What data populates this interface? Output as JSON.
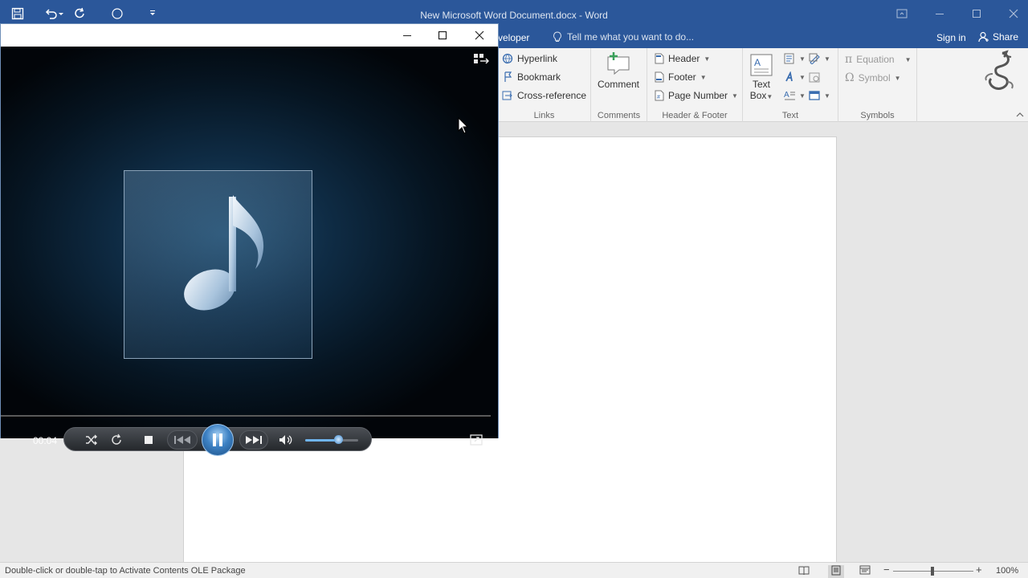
{
  "word": {
    "title": "New Microsoft Word Document.docx - Word",
    "tab_partial": "veloper",
    "tell_me": "Tell me what you want to do...",
    "sign_in": "Sign in",
    "share": "Share"
  },
  "ribbon": {
    "links": {
      "label": "Links",
      "items": [
        "Hyperlink",
        "Bookmark",
        "Cross-reference"
      ]
    },
    "comments": {
      "label": "Comments",
      "comment": "Comment"
    },
    "header_footer": {
      "label": "Header & Footer",
      "header": "Header",
      "footer": "Footer",
      "page_number": "Page Number"
    },
    "text": {
      "label": "Text",
      "text_box_line1": "Text",
      "text_box_line2": "Box"
    },
    "symbols": {
      "label": "Symbols",
      "equation": "Equation",
      "symbol": "Symbol"
    }
  },
  "status": {
    "message": "Double-click or double-tap to Activate Contents OLE Package",
    "zoom": "100%",
    "zoom_level": 100
  },
  "player": {
    "time": "00:04",
    "playing": true,
    "volume_fraction": 0.63
  },
  "colors": {
    "word_blue": "#2b579a",
    "player_accent": "#3e82c4"
  }
}
